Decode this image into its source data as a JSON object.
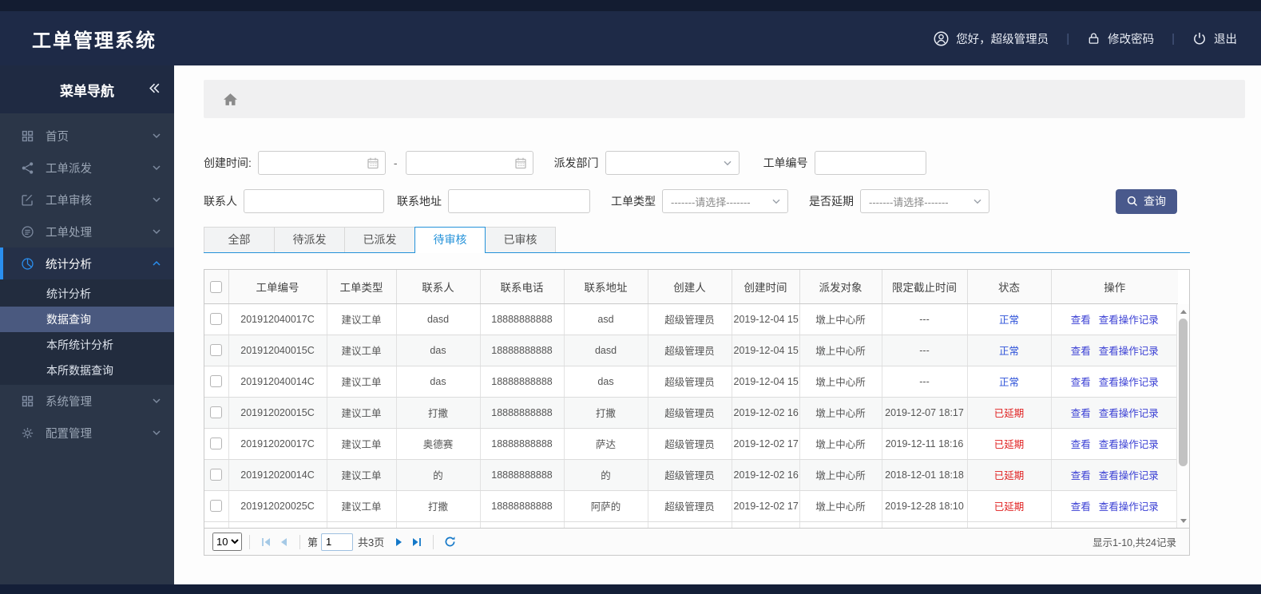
{
  "header": {
    "title": "工单管理系统",
    "greeting": "您好，超级管理员",
    "change_password": "修改密码",
    "logout": "退出"
  },
  "sidebar": {
    "title": "菜单导航",
    "items": [
      {
        "key": "home",
        "label": "首页",
        "icon": "grid-icon",
        "expanded": false
      },
      {
        "key": "order-dispatch",
        "label": "工单派发",
        "icon": "share-icon",
        "expanded": false
      },
      {
        "key": "order-review",
        "label": "工单审核",
        "icon": "edit-icon",
        "expanded": false
      },
      {
        "key": "order-process",
        "label": "工单处理",
        "icon": "process-icon",
        "expanded": false
      },
      {
        "key": "stats-analysis",
        "label": "统计分析",
        "icon": "pie-icon",
        "expanded": true,
        "active": true,
        "children": [
          {
            "key": "stats-analysis",
            "label": "统计分析",
            "selected": false
          },
          {
            "key": "data-query",
            "label": "数据查询",
            "selected": true
          },
          {
            "key": "office-stats-analysis",
            "label": "本所统计分析",
            "selected": false
          },
          {
            "key": "office-data-query",
            "label": "本所数据查询",
            "selected": false
          }
        ]
      },
      {
        "key": "system-mgmt",
        "label": "系统管理",
        "icon": "grid-icon",
        "expanded": false
      },
      {
        "key": "config-mgmt",
        "label": "配置管理",
        "icon": "gear-icon",
        "expanded": false
      }
    ]
  },
  "filters": {
    "created_time_label": "创建时间:",
    "created_from_value": "",
    "date_separator": "-",
    "created_to_value": "",
    "dispatch_dept_label": "派发部门",
    "dispatch_dept_value": "",
    "order_no_label": "工单编号",
    "order_no_value": "",
    "contact_label": "联系人",
    "contact_value": "",
    "address_label": "联系地址",
    "address_value": "",
    "order_type_label": "工单类型",
    "order_type_value": "-------请选择-------",
    "is_delayed_label": "是否延期",
    "is_delayed_value": "-------请选择-------",
    "search_button": "查询"
  },
  "tabs": [
    {
      "key": "all",
      "label": "全部",
      "active": false
    },
    {
      "key": "to-dispatch",
      "label": "待派发",
      "active": false
    },
    {
      "key": "dispatched",
      "label": "已派发",
      "active": false
    },
    {
      "key": "to-review",
      "label": "待审核",
      "active": true
    },
    {
      "key": "reviewed",
      "label": "已审核",
      "active": false
    }
  ],
  "table": {
    "headers": [
      "工单编号",
      "工单类型",
      "联系人",
      "联系电话",
      "联系地址",
      "创建人",
      "创建时间",
      "派发对象",
      "限定截止时间",
      "状态",
      "操作"
    ],
    "actions": [
      "查看",
      "查看操作记录"
    ],
    "rows": [
      {
        "order_no": "201912040017C",
        "order_type": "建议工单",
        "contact": "dasd",
        "phone": "18888888888",
        "address": "asd",
        "creator": "超级管理员",
        "created_time": "2019-12-04 15",
        "dispatch_target": "墩上中心所",
        "deadline": "---",
        "status": "正常",
        "status_type": "normal"
      },
      {
        "order_no": "201912040015C",
        "order_type": "建议工单",
        "contact": "das",
        "phone": "18888888888",
        "address": "dasd",
        "creator": "超级管理员",
        "created_time": "2019-12-04 15",
        "dispatch_target": "墩上中心所",
        "deadline": "---",
        "status": "正常",
        "status_type": "normal"
      },
      {
        "order_no": "201912040014C",
        "order_type": "建议工单",
        "contact": "das",
        "phone": "18888888888",
        "address": "das",
        "creator": "超级管理员",
        "created_time": "2019-12-04 15",
        "dispatch_target": "墩上中心所",
        "deadline": "---",
        "status": "正常",
        "status_type": "normal"
      },
      {
        "order_no": "201912020015C",
        "order_type": "建议工单",
        "contact": "打撒",
        "phone": "18888888888",
        "address": "打撒",
        "creator": "超级管理员",
        "created_time": "2019-12-02 16",
        "dispatch_target": "墩上中心所",
        "deadline": "2019-12-07 18:17",
        "status": "已延期",
        "status_type": "delayed"
      },
      {
        "order_no": "201912020017C",
        "order_type": "建议工单",
        "contact": "奥德赛",
        "phone": "18888888888",
        "address": "萨达",
        "creator": "超级管理员",
        "created_time": "2019-12-02 17",
        "dispatch_target": "墩上中心所",
        "deadline": "2019-12-11 18:16",
        "status": "已延期",
        "status_type": "delayed"
      },
      {
        "order_no": "201912020014C",
        "order_type": "建议工单",
        "contact": "的",
        "phone": "18888888888",
        "address": "的",
        "creator": "超级管理员",
        "created_time": "2019-12-02 16",
        "dispatch_target": "墩上中心所",
        "deadline": "2018-12-01 18:18",
        "status": "已延期",
        "status_type": "delayed"
      },
      {
        "order_no": "201912020025C",
        "order_type": "建议工单",
        "contact": "打撒",
        "phone": "18888888888",
        "address": "阿萨的",
        "creator": "超级管理员",
        "created_time": "2019-12-02 17",
        "dispatch_target": "墩上中心所",
        "deadline": "2019-12-28 18:10",
        "status": "已延期",
        "status_type": "delayed"
      }
    ]
  },
  "pagination": {
    "page_size": "10",
    "page_prefix": "第",
    "page_value": "1",
    "total_pages_label": "共3页",
    "summary": "显示1-10,共24记录"
  },
  "colors": {
    "header_bg": "#1e2a47",
    "sidebar_bg": "#2b3648",
    "submenu_selected_bg": "#4a597f",
    "accent_blue": "#2492d9",
    "menu_active_blue": "#2a8ff0",
    "status_normal": "#2b50d8",
    "status_delayed": "#e01f1f",
    "link_blue": "#3a3fd4",
    "search_button_bg": "#49598c",
    "footer_bg": "#141f38"
  }
}
